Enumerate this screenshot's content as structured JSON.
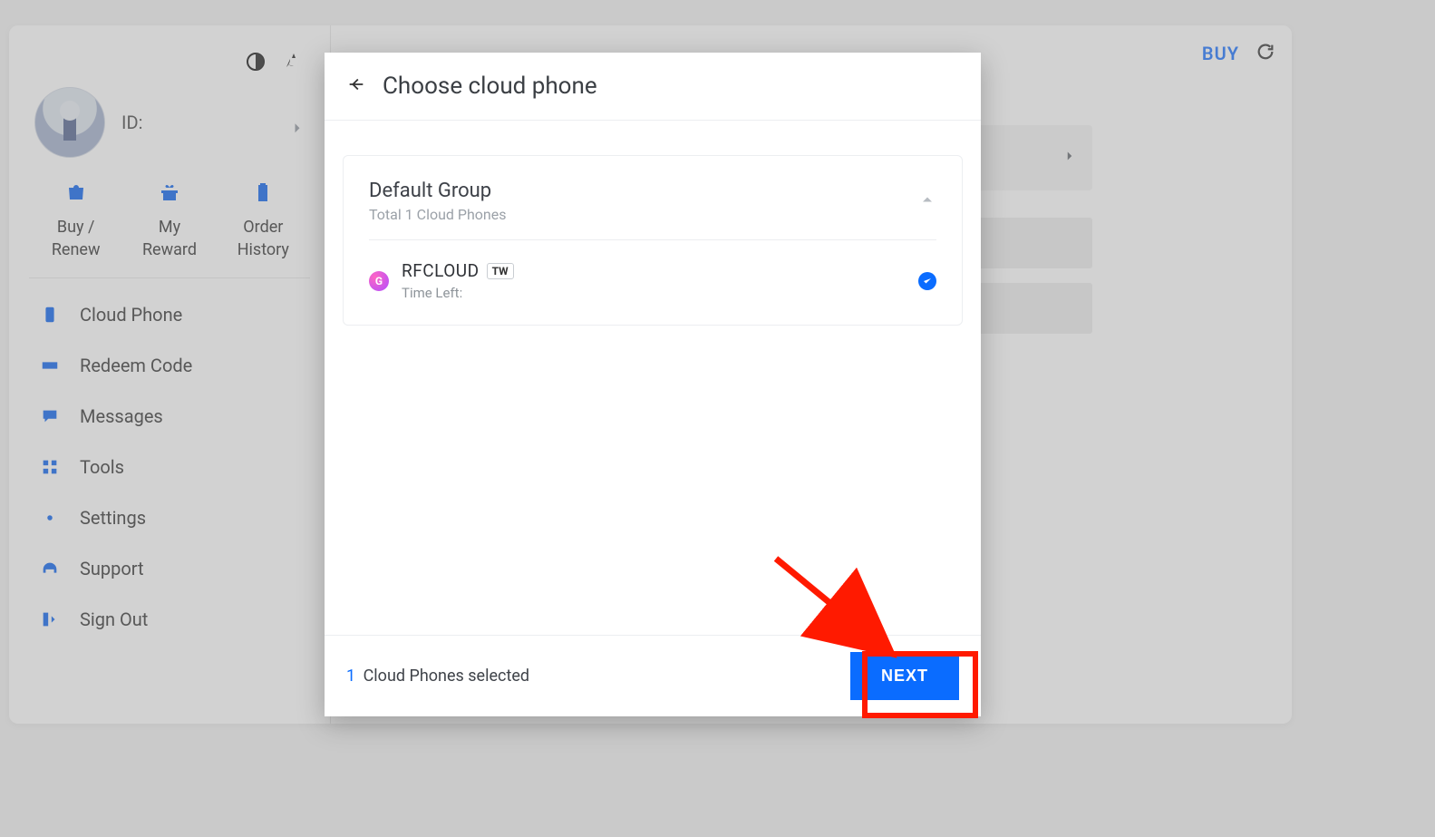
{
  "header": {
    "buy_label": "BUY"
  },
  "profile": {
    "id_label": "ID:"
  },
  "quick": [
    {
      "label_line1": "Buy /",
      "label_line2": "Renew"
    },
    {
      "label_line1": "My",
      "label_line2": "Reward"
    },
    {
      "label_line1": "Order",
      "label_line2": "History"
    }
  ],
  "nav": [
    {
      "label": "Cloud Phone"
    },
    {
      "label": "Redeem Code"
    },
    {
      "label": "Messages"
    },
    {
      "label": "Tools"
    },
    {
      "label": "Settings"
    },
    {
      "label": "Support"
    },
    {
      "label": "Sign Out"
    }
  ],
  "modal": {
    "title": "Choose cloud phone",
    "group": {
      "name": "Default Group",
      "subtitle": "Total 1 Cloud Phones",
      "phone": {
        "badge": "G",
        "name": "RFCLOUD",
        "tag": "TW",
        "time_left_label": "Time Left:"
      }
    },
    "footer": {
      "selected_count": "1",
      "selected_text": "Cloud Phones selected",
      "next_label": "NEXT"
    }
  }
}
